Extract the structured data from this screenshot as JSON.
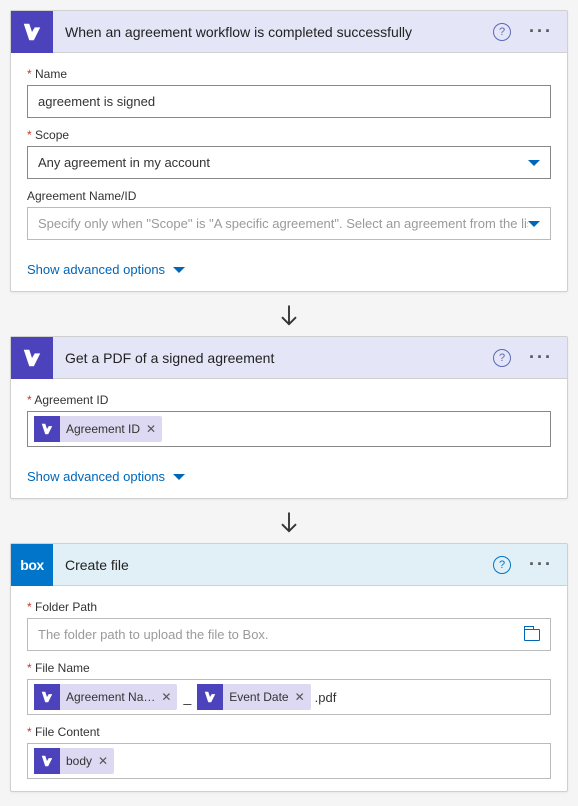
{
  "step1": {
    "title": "When an agreement workflow is completed successfully",
    "name_label": "Name",
    "name_value": "agreement is signed",
    "scope_label": "Scope",
    "scope_value": "Any agreement in my account",
    "agreement_label": "Agreement Name/ID",
    "agreement_placeholder": "Specify only when \"Scope\" is \"A specific agreement\". Select an agreement from the list or en",
    "show_advanced": "Show advanced options"
  },
  "step2": {
    "title": "Get a PDF of a signed agreement",
    "agreement_id_label": "Agreement ID",
    "token_agreement_id": "Agreement ID",
    "show_advanced": "Show advanced options"
  },
  "step3": {
    "title": "Create file",
    "folder_label": "Folder Path",
    "folder_placeholder": "The folder path to upload the file to Box.",
    "filename_label": "File Name",
    "token_agreement_name": "Agreement Na…",
    "token_event_date": "Event Date",
    "filename_suffix": ".pdf",
    "filename_sep": "_",
    "filecontent_label": "File Content",
    "token_body": "body"
  }
}
